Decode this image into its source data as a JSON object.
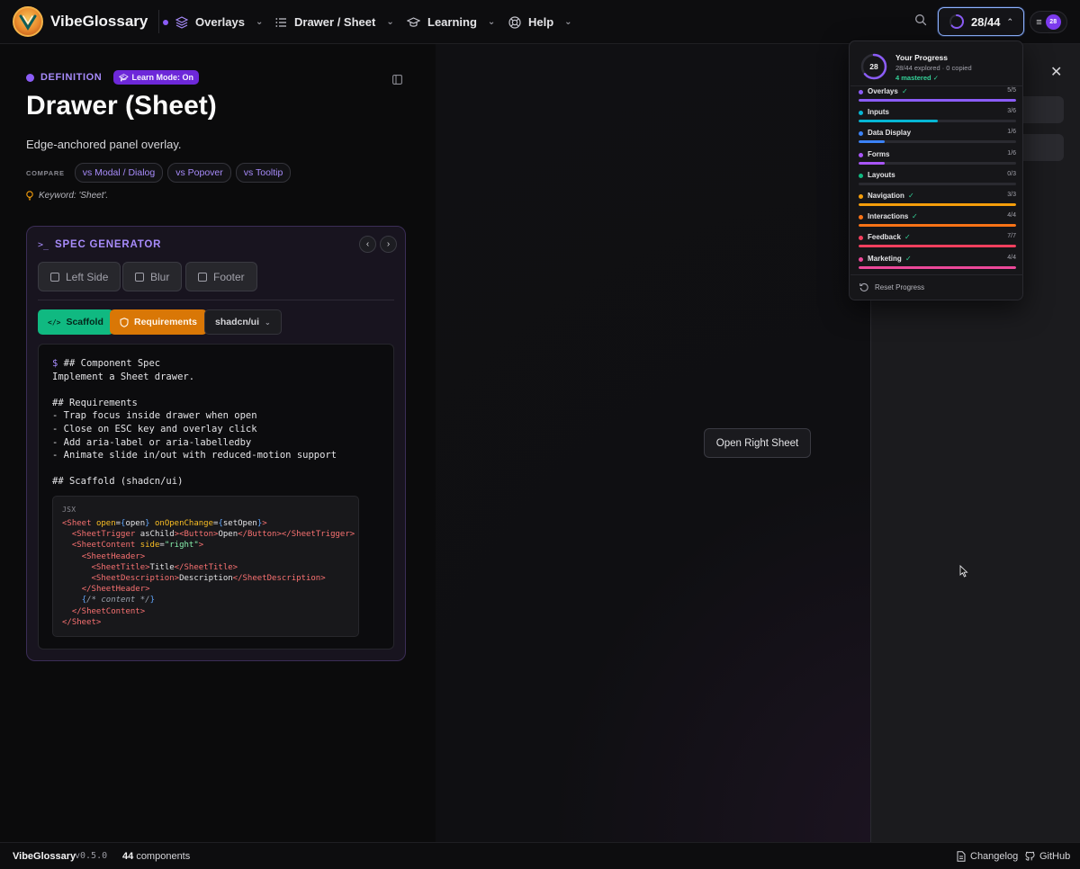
{
  "app": {
    "name": "VibeGlossary",
    "version": "v0.5.0"
  },
  "nav": {
    "overlays": "Overlays",
    "drawer_sheet": "Drawer / Sheet",
    "learning": "Learning",
    "help": "Help",
    "progress_label": "28/44",
    "menu_badge": "28"
  },
  "definition": {
    "label": "DEFINITION",
    "learn_mode": "Learn Mode: On",
    "title": "Drawer (Sheet)",
    "description": "Edge-anchored panel overlay.",
    "compare_label": "COMPARE",
    "compare": [
      "vs Modal / Dialog",
      "vs Popover",
      "vs Tooltip"
    ],
    "keyword": "Keyword: 'Sheet'."
  },
  "spec": {
    "title": "SPEC GENERATOR",
    "toggles": [
      "Left Side",
      "Blur",
      "Footer"
    ],
    "scaffold_label": "Scaffold",
    "requirements_label": "Requirements",
    "library": "shadcn/ui",
    "code_prompt": "$",
    "code_lines": [
      "## Component Spec",
      "Implement a Sheet drawer.",
      "",
      "## Requirements",
      "- Trap focus inside drawer when open",
      "- Close on ESC key and overlay click",
      "- Add aria-label or aria-labelledby",
      "- Animate slide in/out with reduced-motion support",
      "",
      "## Scaffold (shadcn/ui)"
    ],
    "jsx_label": "JSX"
  },
  "demo": {
    "open_button": "Open Right Sheet"
  },
  "progress": {
    "ring_value": "28",
    "title": "Your Progress",
    "subtitle": "28/44 explored · 0 copied",
    "mastered": "4 mastered ✓",
    "fraction": 0.636,
    "categories": [
      {
        "name": "Overlays",
        "count": "5/5",
        "done": true,
        "ratio": 1.0,
        "color": "#8b5cf6"
      },
      {
        "name": "Inputs",
        "count": "3/6",
        "done": false,
        "ratio": 0.5,
        "color": "#06b6d4"
      },
      {
        "name": "Data Display",
        "count": "1/6",
        "done": false,
        "ratio": 0.167,
        "color": "#3b82f6"
      },
      {
        "name": "Forms",
        "count": "1/6",
        "done": false,
        "ratio": 0.167,
        "color": "#a855f7"
      },
      {
        "name": "Layouts",
        "count": "0/3",
        "done": false,
        "ratio": 0.0,
        "color": "#10b981"
      },
      {
        "name": "Navigation",
        "count": "3/3",
        "done": true,
        "ratio": 1.0,
        "color": "#f59e0b"
      },
      {
        "name": "Interactions",
        "count": "4/4",
        "done": true,
        "ratio": 1.0,
        "color": "#f97316"
      },
      {
        "name": "Feedback",
        "count": "7/7",
        "done": true,
        "ratio": 1.0,
        "color": "#f43f5e"
      },
      {
        "name": "Marketing",
        "count": "4/4",
        "done": true,
        "ratio": 1.0,
        "color": "#ec4899"
      }
    ],
    "reset": "Reset Progress"
  },
  "footer": {
    "count_number": "44",
    "count_label": "components",
    "changelog": "Changelog",
    "github": "GitHub"
  }
}
